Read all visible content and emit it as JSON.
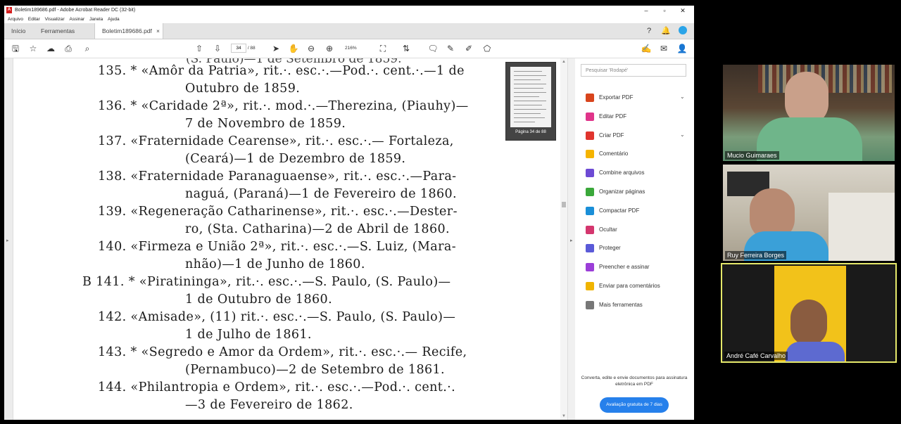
{
  "window": {
    "title": "Boletim189686.pdf - Adobe Acrobat Reader DC (32-bit)",
    "controls": {
      "minimize": "–",
      "maximize": "▫",
      "close": "✕"
    }
  },
  "menu": [
    "Arquivo",
    "Editar",
    "Visualizar",
    "Assinar",
    "Janela",
    "Ajuda"
  ],
  "tabs": {
    "home": "Início",
    "tools": "Ferramentas",
    "document": "Boletim189686.pdf",
    "close": "×"
  },
  "toolbar": {
    "current_page": "34",
    "total_pages": "/ 88",
    "zoom": "216%"
  },
  "document": {
    "cut_top_line": "(S. Paulo)—1 de Setembro de 1859.",
    "lines": [
      "135. * «Amôr da Patria», rit.·. esc.·.—Pod.·. cent.·.—1 de",
      "Outubro de 1859.",
      "136. * «Caridade 2ª», rit.·. mod.·.—Therezina, (Piauhy)—",
      "7 de Novembro de 1859.",
      "137.  «Fraternidade Cearense», rit.·. esc.·.— Fortaleza,",
      "(Ceará)—1 de Dezembro de 1859.",
      "138.  «Fraternidade Paranaguaense», rit.·. esc.·.—Para-",
      "naguá, (Paraná)—1 de Fevereiro de 1860.",
      "139.  «Regeneração Catharinense», rit.·. esc.·.—Dester-",
      "ro, (Sta. Catharina)—2 de Abril de 1860.",
      "140.  «Firmeza e União 2ª», rit.·. esc.·.—S. Luiz, (Mara-",
      "nhão)—1 de Junho de 1860.",
      "B 141. * «Piratininga», rit.·. esc.·.—S. Paulo, (S. Paulo)—",
      "1 de Outubro de 1860.",
      "142.  «Amisade», (11) rit.·. esc.·.—S. Paulo, (S. Paulo)—",
      "1 de Julho de 1861.",
      "143. * «Segredo e Amor da Ordem», rit.·. esc.·.— Recife,",
      "(Pernambuco)—2 de Setembro de 1861.",
      "144.  «Philantropia e Ordem», rit.·. esc.·.—Pod.·. cent.·.",
      "—3 de Fevereiro de 1862."
    ]
  },
  "thumbnail": {
    "label": "Página 34 de 88"
  },
  "right_panel": {
    "search_placeholder": "Pesquisar 'Rodapé'",
    "tools": [
      {
        "label": "Exportar PDF",
        "icon": "export-pdf-icon",
        "color": "#d8441c",
        "chevron": "⌄"
      },
      {
        "label": "Editar PDF",
        "icon": "edit-pdf-icon",
        "color": "#e0348a",
        "chevron": ""
      },
      {
        "label": "Criar PDF",
        "icon": "create-pdf-icon",
        "color": "#e0342d",
        "chevron": "⌄"
      },
      {
        "label": "Comentário",
        "icon": "comment-icon",
        "color": "#f5b400",
        "chevron": ""
      },
      {
        "label": "Combine arquivos",
        "icon": "combine-files-icon",
        "color": "#6d4ad4",
        "chevron": ""
      },
      {
        "label": "Organizar páginas",
        "icon": "organize-pages-icon",
        "color": "#3aa83a",
        "chevron": ""
      },
      {
        "label": "Compactar PDF",
        "icon": "compress-pdf-icon",
        "color": "#1a8fd8",
        "chevron": ""
      },
      {
        "label": "Ocultar",
        "icon": "redact-icon",
        "color": "#d4366e",
        "chevron": ""
      },
      {
        "label": "Proteger",
        "icon": "protect-icon",
        "color": "#5a5ad8",
        "chevron": ""
      },
      {
        "label": "Preencher e assinar",
        "icon": "fill-sign-icon",
        "color": "#9b3ed8",
        "chevron": ""
      },
      {
        "label": "Enviar para comentários",
        "icon": "send-review-icon",
        "color": "#f0b400",
        "chevron": ""
      },
      {
        "label": "Mais ferramentas",
        "icon": "more-tools-icon",
        "color": "#777777",
        "chevron": ""
      }
    ],
    "promo_text": "Converta, edite e envie documentos para assinatura eletrônica em PDF",
    "trial_button": "Avaliação gratuita de 7 dias"
  },
  "participants": [
    {
      "name": "Mucio Guimaraes",
      "active": false
    },
    {
      "name": "Ruy Ferreira Borges",
      "active": false
    },
    {
      "name": "André Café Carvalho",
      "active": true
    }
  ]
}
